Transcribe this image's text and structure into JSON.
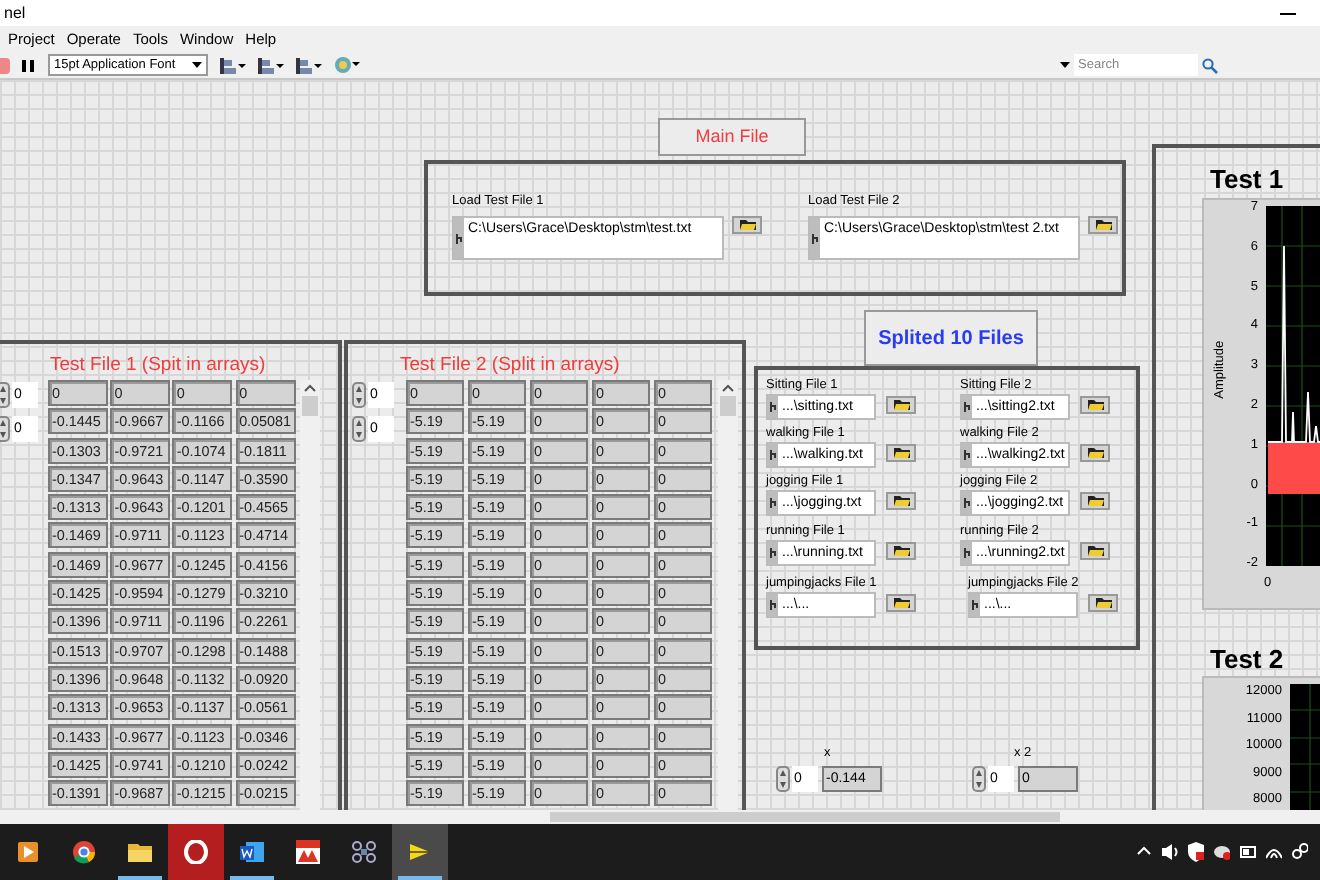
{
  "window": {
    "title": "nel"
  },
  "menu": [
    "Project",
    "Operate",
    "Tools",
    "Window",
    "Help"
  ],
  "toolbar": {
    "font": "15pt Application Font",
    "search": {
      "placeholder": "Search"
    }
  },
  "main_file": {
    "title": "Main File",
    "inputs": [
      {
        "label": "Load Test File 1",
        "path": "C:\\Users\\Grace\\Desktop\\stm\\test.txt"
      },
      {
        "label": "Load Test File 2",
        "path": "C:\\Users\\Grace\\Desktop\\stm\\test 2.txt"
      }
    ]
  },
  "test_file_1": {
    "title": "Test File 1 (Spit in arrays)",
    "indices": [
      "0",
      "0"
    ],
    "rows": [
      [
        "0",
        "0",
        "0",
        "0"
      ],
      [
        "-0.1445",
        "-0.9667",
        "-0.1166",
        "0.05081"
      ],
      [
        "-0.1303",
        "-0.9721",
        "-0.1074",
        "-0.1811"
      ],
      [
        "-0.1347",
        "-0.9643",
        "-0.1147",
        "-0.3590"
      ],
      [
        "-0.1313",
        "-0.9643",
        "-0.1201",
        "-0.4565"
      ],
      [
        "-0.1469",
        "-0.9711",
        "-0.1123",
        "-0.4714"
      ],
      [
        "-0.1469",
        "-0.9677",
        "-0.1245",
        "-0.4156"
      ],
      [
        "-0.1425",
        "-0.9594",
        "-0.1279",
        "-0.3210"
      ],
      [
        "-0.1396",
        "-0.9711",
        "-0.1196",
        "-0.2261"
      ],
      [
        "-0.1513",
        "-0.9707",
        "-0.1298",
        "-0.1488"
      ],
      [
        "-0.1396",
        "-0.9648",
        "-0.1132",
        "-0.0920"
      ],
      [
        "-0.1313",
        "-0.9653",
        "-0.1137",
        "-0.0561"
      ],
      [
        "-0.1433",
        "-0.9677",
        "-0.1123",
        "-0.0346"
      ],
      [
        "-0.1425",
        "-0.9741",
        "-0.1210",
        "-0.0242"
      ],
      [
        "-0.1391",
        "-0.9687",
        "-0.1215",
        "-0.0215"
      ]
    ]
  },
  "test_file_2": {
    "title": "Test File 2 (Split in arrays)",
    "indices": [
      "0",
      "0"
    ],
    "rows": [
      [
        "0",
        "0",
        "0",
        "0",
        "0"
      ],
      [
        "-5.19",
        "-5.19",
        "0",
        "0",
        "0"
      ],
      [
        "-5.19",
        "-5.19",
        "0",
        "0",
        "0"
      ],
      [
        "-5.19",
        "-5.19",
        "0",
        "0",
        "0"
      ],
      [
        "-5.19",
        "-5.19",
        "0",
        "0",
        "0"
      ],
      [
        "-5.19",
        "-5.19",
        "0",
        "0",
        "0"
      ],
      [
        "-5.19",
        "-5.19",
        "0",
        "0",
        "0"
      ],
      [
        "-5.19",
        "-5.19",
        "0",
        "0",
        "0"
      ],
      [
        "-5.19",
        "-5.19",
        "0",
        "0",
        "0"
      ],
      [
        "-5.19",
        "-5.19",
        "0",
        "0",
        "0"
      ],
      [
        "-5.19",
        "-5.19",
        "0",
        "0",
        "0"
      ],
      [
        "-5.19",
        "-5.19",
        "0",
        "0",
        "0"
      ],
      [
        "-5.19",
        "-5.19",
        "0",
        "0",
        "0"
      ],
      [
        "-5.19",
        "-5.19",
        "0",
        "0",
        "0"
      ],
      [
        "-5.19",
        "-5.19",
        "0",
        "0",
        "0"
      ]
    ]
  },
  "split_files": {
    "title": "Splited 10 Files",
    "files": [
      {
        "label": "Sitting File 1",
        "path": "...\\sitting.txt"
      },
      {
        "label": "Sitting File 2",
        "path": "...\\sitting2.txt"
      },
      {
        "label": "walking File 1",
        "path": "...\\walking.txt"
      },
      {
        "label": "walking File 2",
        "path": "...\\walking2.txt"
      },
      {
        "label": "jogging File 1",
        "path": "...\\jogging.txt"
      },
      {
        "label": "jogging File 2",
        "path": "...\\jogging2.txt"
      },
      {
        "label": "running File 1",
        "path": "...\\running.txt"
      },
      {
        "label": "running File 2",
        "path": "...\\running2.txt"
      },
      {
        "label": "jumpingjacks File 1",
        "path": "...\\..."
      },
      {
        "label": "jumpingjacks File 2",
        "path": "...\\..."
      }
    ]
  },
  "x_controls": [
    {
      "label": "x",
      "index": "0",
      "value": "-0.144"
    },
    {
      "label": "x 2",
      "index": "0",
      "value": "0"
    }
  ],
  "charts": [
    {
      "title": "Test 1",
      "ylabel": "Amplitude",
      "yticks": [
        "7",
        "6",
        "5",
        "4",
        "3",
        "2",
        "1",
        "0",
        "-1",
        "-2"
      ],
      "xticks": [
        "0"
      ]
    },
    {
      "title": "Test 2",
      "yticks": [
        "12000",
        "11000",
        "10000",
        "9000",
        "8000"
      ]
    }
  ],
  "taskbar": [
    {
      "kind": "media",
      "open": false,
      "selected": false
    },
    {
      "kind": "chrome",
      "open": false,
      "selected": false
    },
    {
      "kind": "folder",
      "open": true,
      "selected": false
    },
    {
      "kind": "opera",
      "open": false,
      "selected": false
    },
    {
      "kind": "word",
      "open": true,
      "selected": false
    },
    {
      "kind": "matlab",
      "open": false,
      "selected": false
    },
    {
      "kind": "drone",
      "open": false,
      "selected": false
    },
    {
      "kind": "labview",
      "open": true,
      "selected": true
    }
  ]
}
